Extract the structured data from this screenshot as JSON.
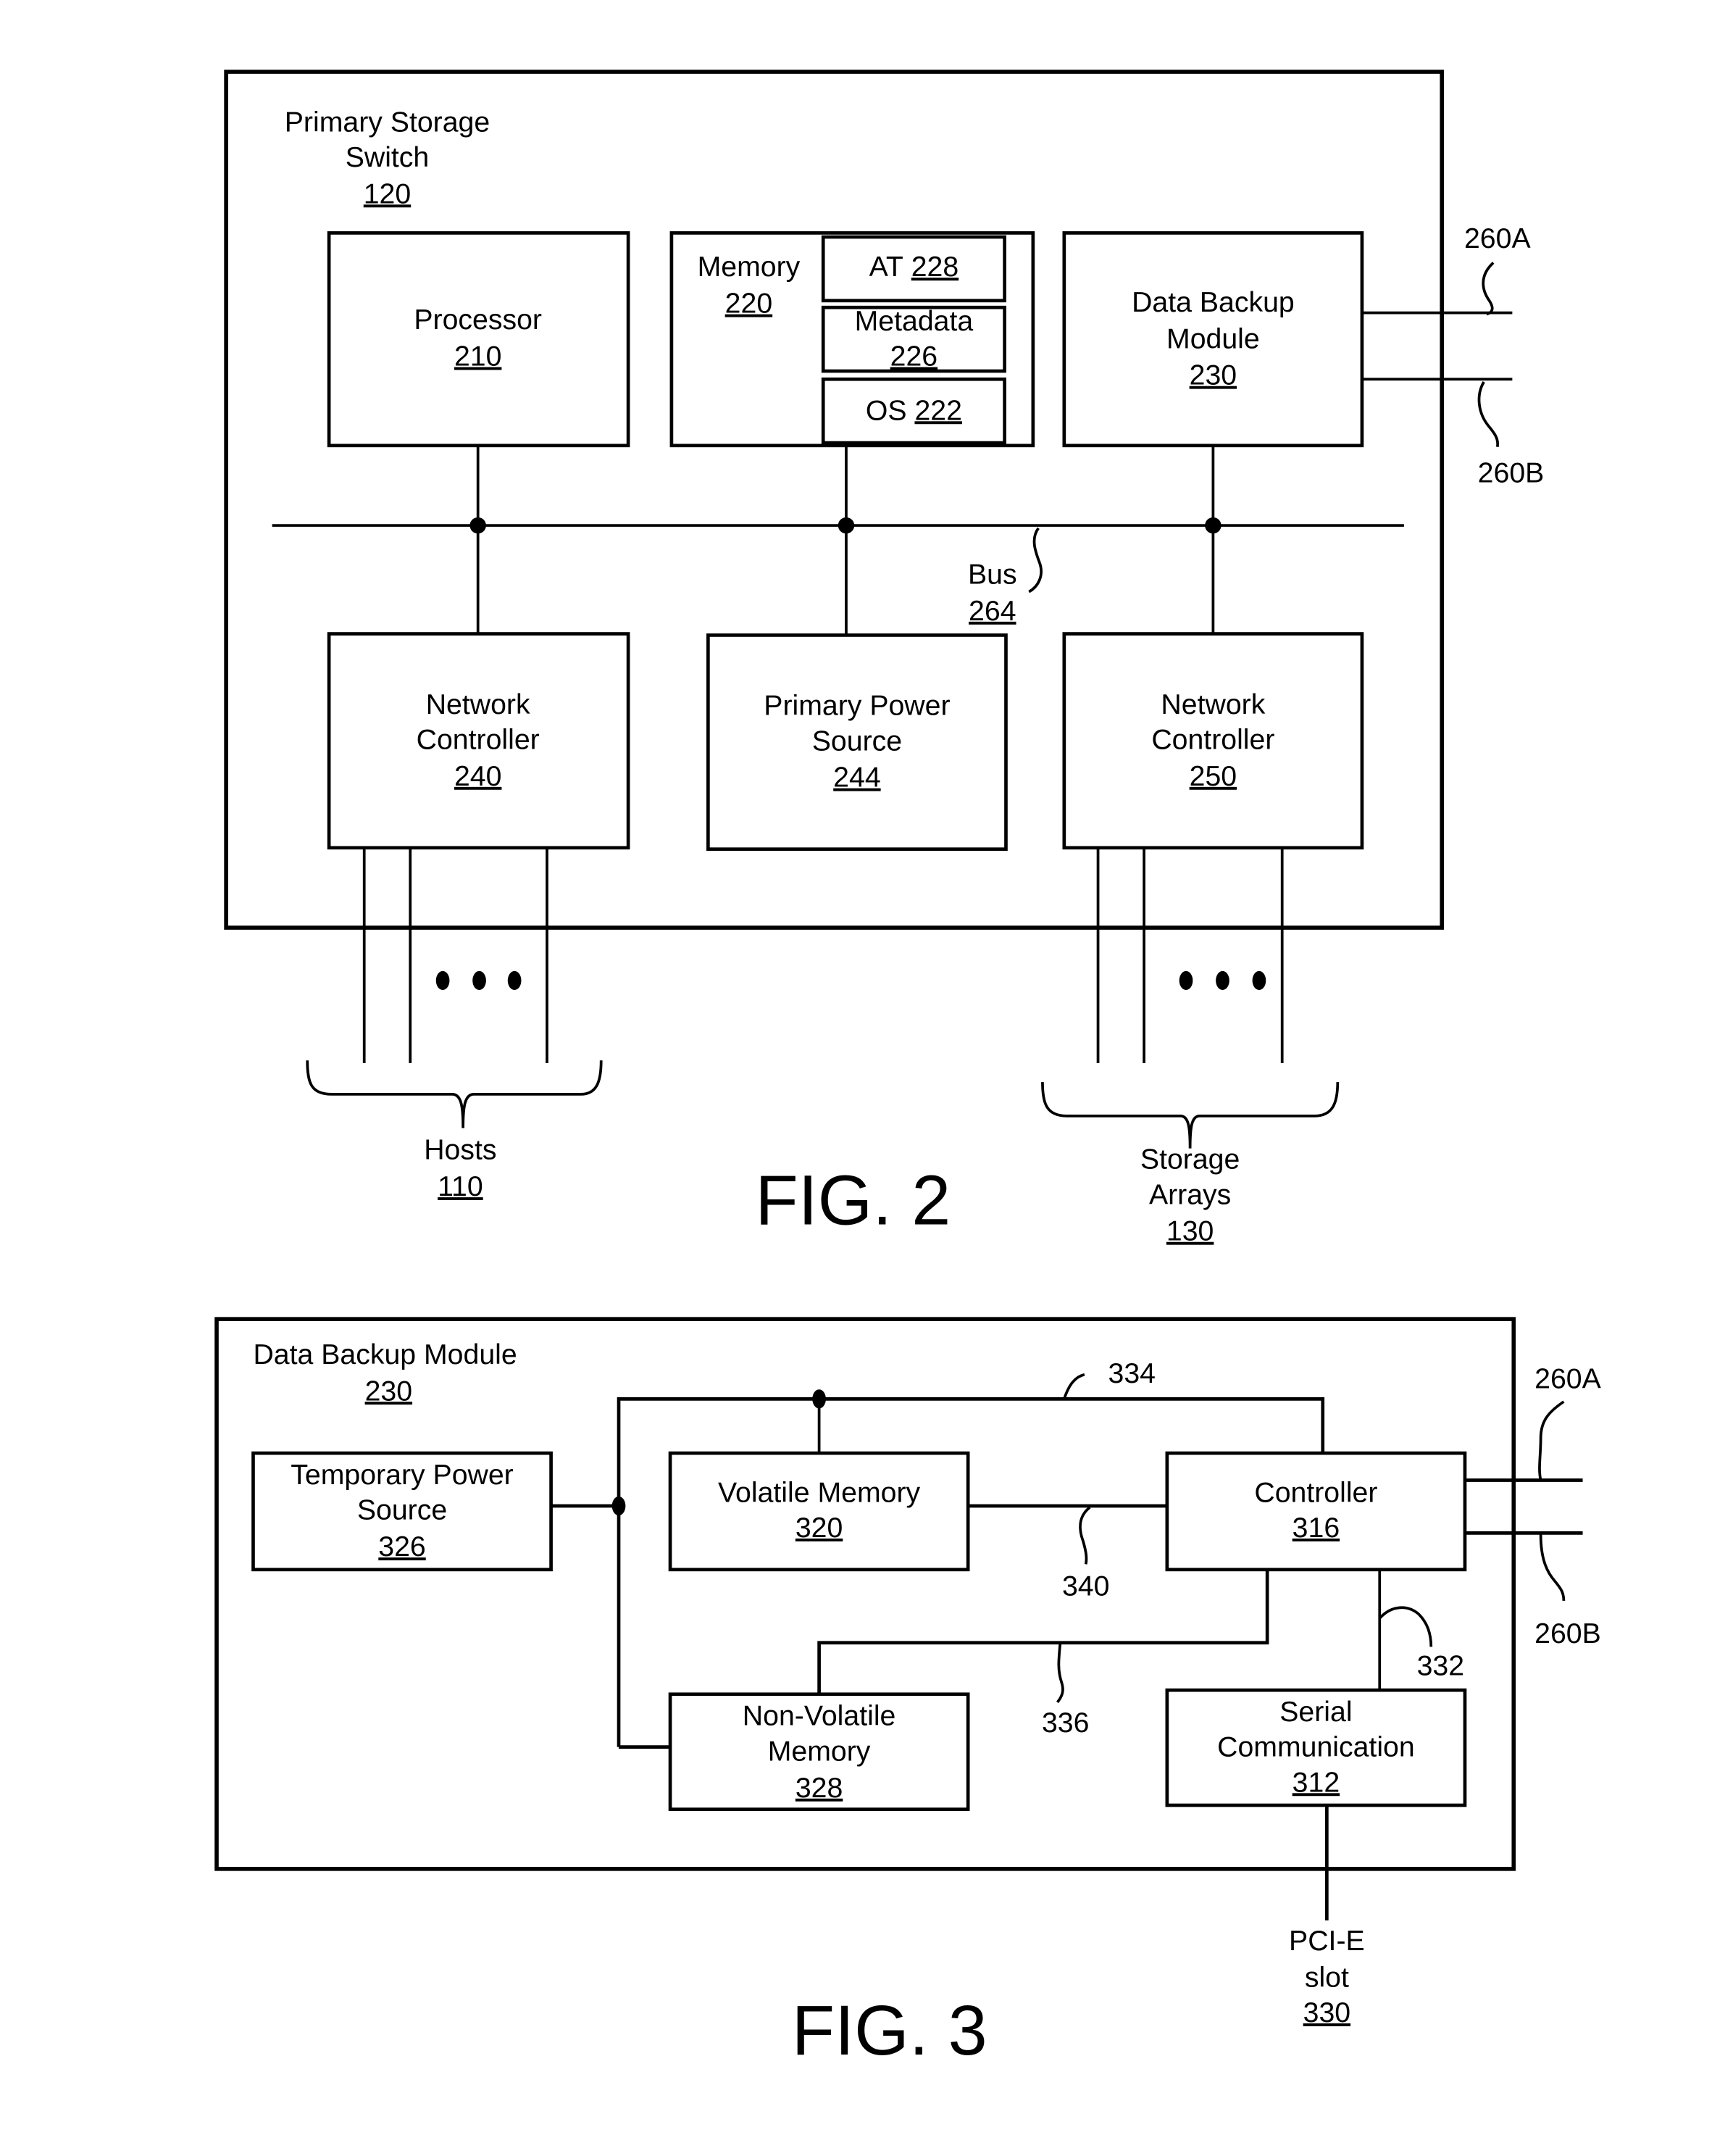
{
  "fig2": {
    "caption": "FIG. 2",
    "switch": {
      "line1": "Primary Storage",
      "line2": "Switch",
      "ref": "120"
    },
    "processor": {
      "label": "Processor",
      "ref": "210"
    },
    "memory": {
      "label": "Memory",
      "ref": "220",
      "at": {
        "label": "AT",
        "ref": "228"
      },
      "metadata": {
        "label": "Metadata",
        "ref": "226"
      },
      "os": {
        "label": "OS",
        "ref": "222"
      }
    },
    "backup": {
      "line1": "Data Backup",
      "line2": "Module",
      "ref": "230"
    },
    "bus": {
      "label": "Bus",
      "ref": "264"
    },
    "nc240": {
      "line1": "Network",
      "line2": "Controller",
      "ref": "240"
    },
    "power": {
      "line1": "Primary Power",
      "line2": "Source",
      "ref": "244"
    },
    "nc250": {
      "line1": "Network",
      "line2": "Controller",
      "ref": "250"
    },
    "link_a": "260A",
    "link_b": "260B",
    "hosts": {
      "label": "Hosts",
      "ref": "110"
    },
    "arrays": {
      "line1": "Storage",
      "line2": "Arrays",
      "ref": "130"
    }
  },
  "fig3": {
    "caption": "FIG. 3",
    "module": {
      "label": "Data Backup Module",
      "ref": "230"
    },
    "temp_power": {
      "line1": "Temporary Power",
      "line2": "Source",
      "ref": "326"
    },
    "volatile": {
      "label": "Volatile Memory",
      "ref": "320"
    },
    "controller": {
      "label": "Controller",
      "ref": "316"
    },
    "nonvolatile": {
      "line1": "Non-Volatile",
      "line2": "Memory",
      "ref": "328"
    },
    "serial": {
      "line1": "Serial",
      "line2": "Communication",
      "ref": "312"
    },
    "pcie": {
      "line1": "PCI-E",
      "line2": "slot",
      "ref": "330"
    },
    "ref_334": "334",
    "ref_340": "340",
    "ref_336": "336",
    "ref_332": "332",
    "link_a": "260A",
    "link_b": "260B"
  }
}
